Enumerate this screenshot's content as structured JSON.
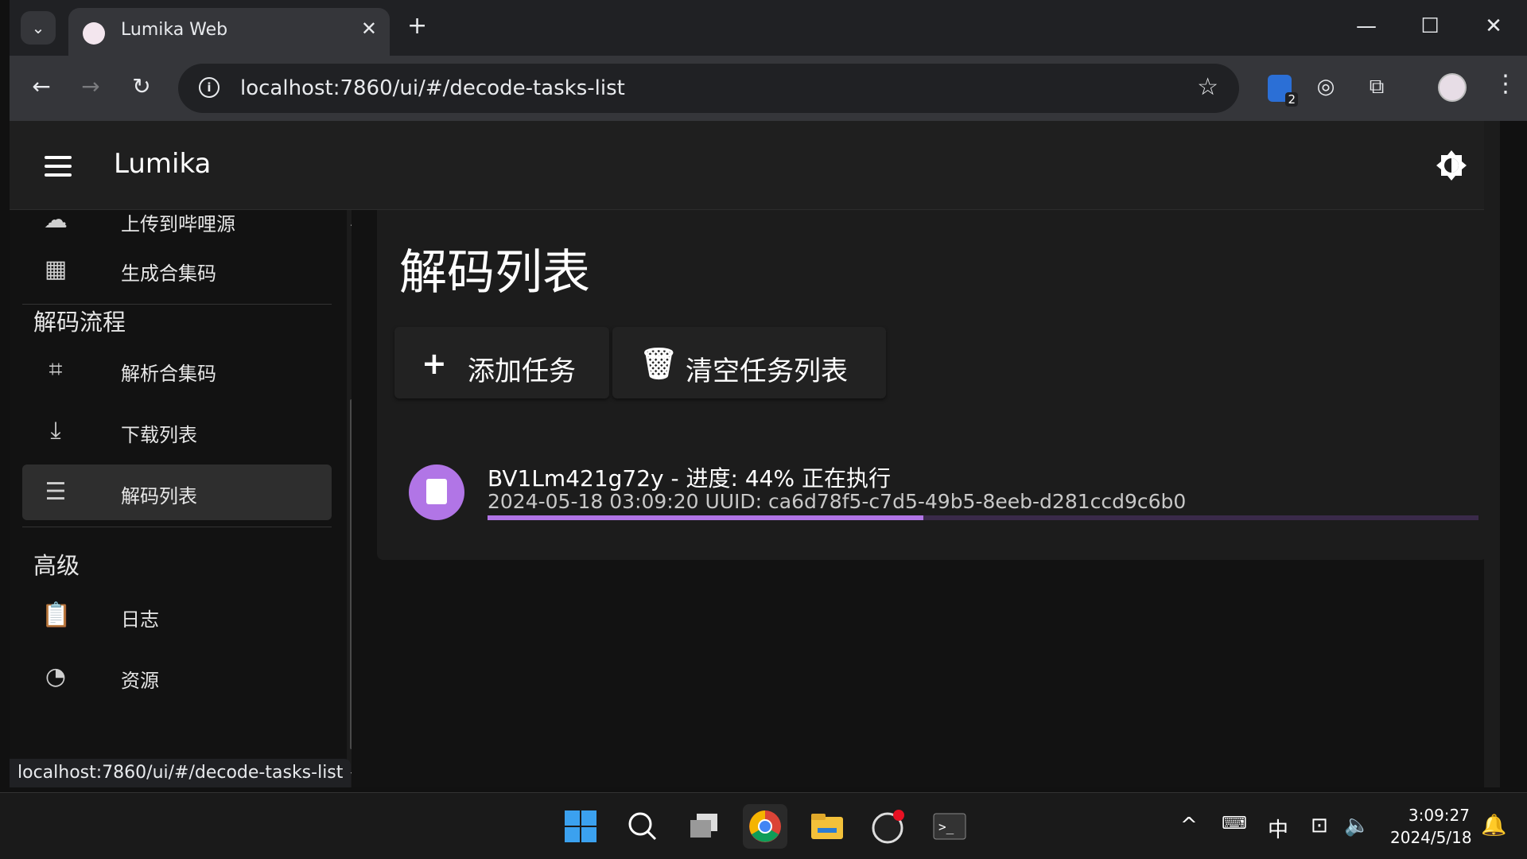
{
  "browser": {
    "tab_title": "Lumika Web",
    "tab_close": "✕",
    "new_tab": "+",
    "url": "localhost:7860/ui/#/decode-tasks-list",
    "extension_badge_count": "2"
  },
  "window": {
    "minimize": "—",
    "maximize": "☐",
    "close": "✕"
  },
  "app": {
    "title": "Lumika"
  },
  "drawer": {
    "items_top": [
      {
        "label": "上传到哔哩源",
        "icon": "cloud-upload-icon"
      },
      {
        "label": "生成合集码",
        "icon": "qr-code-icon"
      }
    ],
    "section_decode": "解码流程",
    "items_decode": [
      {
        "label": "解析合集码",
        "icon": "qr-scan-icon"
      },
      {
        "label": "下载列表",
        "icon": "download-icon"
      },
      {
        "label": "解码列表",
        "icon": "list-icon",
        "active": true
      }
    ],
    "section_advanced": "高级",
    "items_advanced": [
      {
        "label": "日志",
        "icon": "clipboard-icon"
      },
      {
        "label": "资源",
        "icon": "speedometer-icon"
      }
    ]
  },
  "status_url": "localhost:7860/ui/#/decode-tasks-list",
  "main": {
    "page_title": "解码列表",
    "add_button": "添加任务",
    "clear_button": "清空任务列表",
    "task": {
      "title": "BV1Lm421g72y - 进度: 44% 正在执行",
      "subtitle": "2024-05-18 03:09:20 UUID: ca6d78f5-c7d5-49b5-8eeb-d281ccd9c6b0",
      "progress": 0.44
    }
  },
  "taskbar": {
    "ime": "中",
    "time": "3:09:27",
    "date": "2024/5/18"
  },
  "colors": {
    "accent": "#b175e6",
    "background": "#121212",
    "card": "#1c1c1c"
  }
}
